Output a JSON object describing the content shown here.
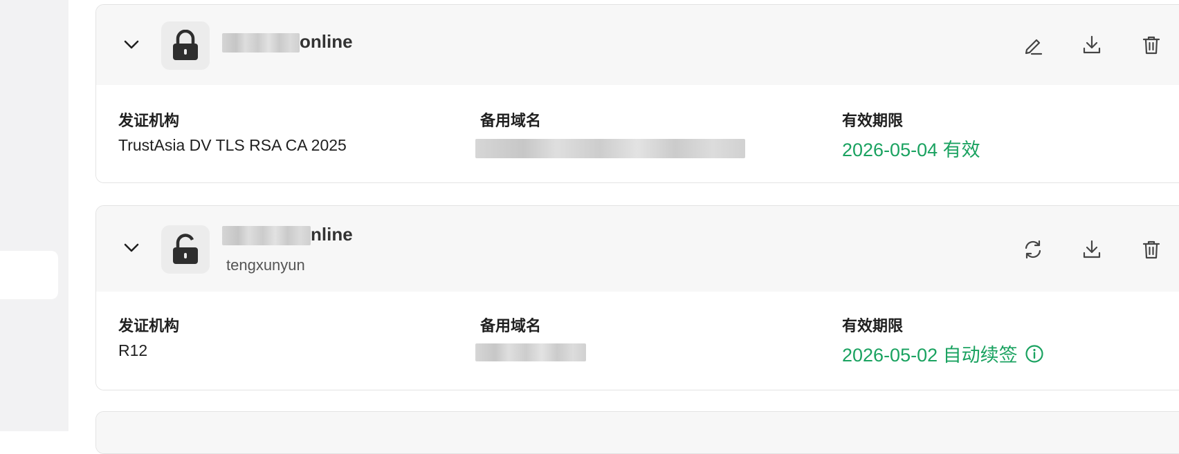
{
  "certificates": [
    {
      "domain_suffix": "online",
      "provider": "",
      "actions": [
        "edit-icon",
        "download-icon",
        "delete-icon"
      ],
      "issuer_label": "发证机构",
      "issuer": "TrustAsia DV TLS RSA CA 2025",
      "alt_label": "备用域名",
      "expiry_label": "有效期限",
      "expiry": "2026-05-04 有效"
    },
    {
      "domain_suffix": "nline",
      "provider": "tengxunyun",
      "actions": [
        "refresh-icon",
        "download-icon",
        "delete-icon"
      ],
      "issuer_label": "发证机构",
      "issuer": "R12",
      "alt_label": "备用域名",
      "expiry_label": "有效期限",
      "expiry": "2026-05-02 自动续签"
    }
  ],
  "colors": {
    "status_green": "#1aa260",
    "header_bg": "#f7f7f7"
  }
}
